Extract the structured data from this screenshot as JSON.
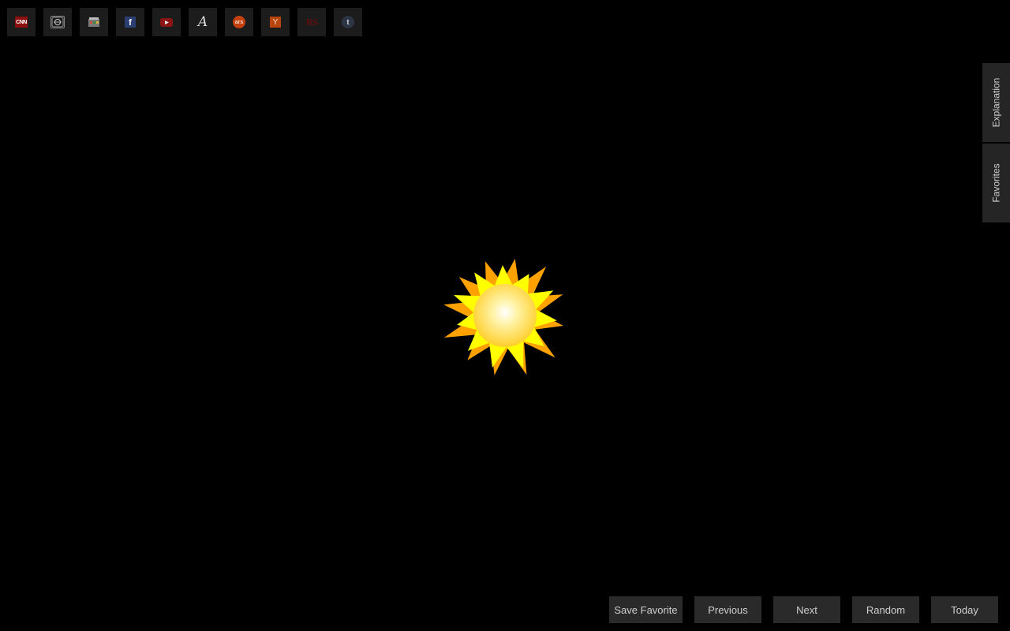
{
  "shortcuts": [
    {
      "name": "cnn",
      "glyph": "CNN",
      "icon": "cnn-icon"
    },
    {
      "name": "news",
      "glyph": "",
      "icon": "news-icon"
    },
    {
      "name": "store",
      "glyph": "",
      "icon": "store-icon"
    },
    {
      "name": "facebook",
      "glyph": "f",
      "icon": "facebook-icon"
    },
    {
      "name": "youtube",
      "glyph": "",
      "icon": "youtube-icon"
    },
    {
      "name": "atlantic",
      "glyph": "A",
      "icon": "atlantic-icon"
    },
    {
      "name": "ars-technica",
      "glyph": "ars",
      "icon": "ars-technica-icon"
    },
    {
      "name": "hacker-news",
      "glyph": "Y",
      "icon": "hacker-news-icon"
    },
    {
      "name": "rolling-stone",
      "glyph": "RS",
      "icon": "rolling-stone-icon"
    },
    {
      "name": "tumblr",
      "glyph": "t",
      "icon": "tumblr-icon"
    }
  ],
  "side_tabs": {
    "explanation": "Explanation",
    "favorites": "Favorites"
  },
  "nav": {
    "save_favorite": "Save Favorite",
    "previous": "Previous",
    "next": "Next",
    "random": "Random",
    "today": "Today"
  },
  "colors": {
    "background": "#000000",
    "button_bg": "#2a2a2a",
    "sun_outer_rays": "#ffa200",
    "sun_inner_rays": "#ffff00",
    "sun_core": "#ffd23a"
  }
}
